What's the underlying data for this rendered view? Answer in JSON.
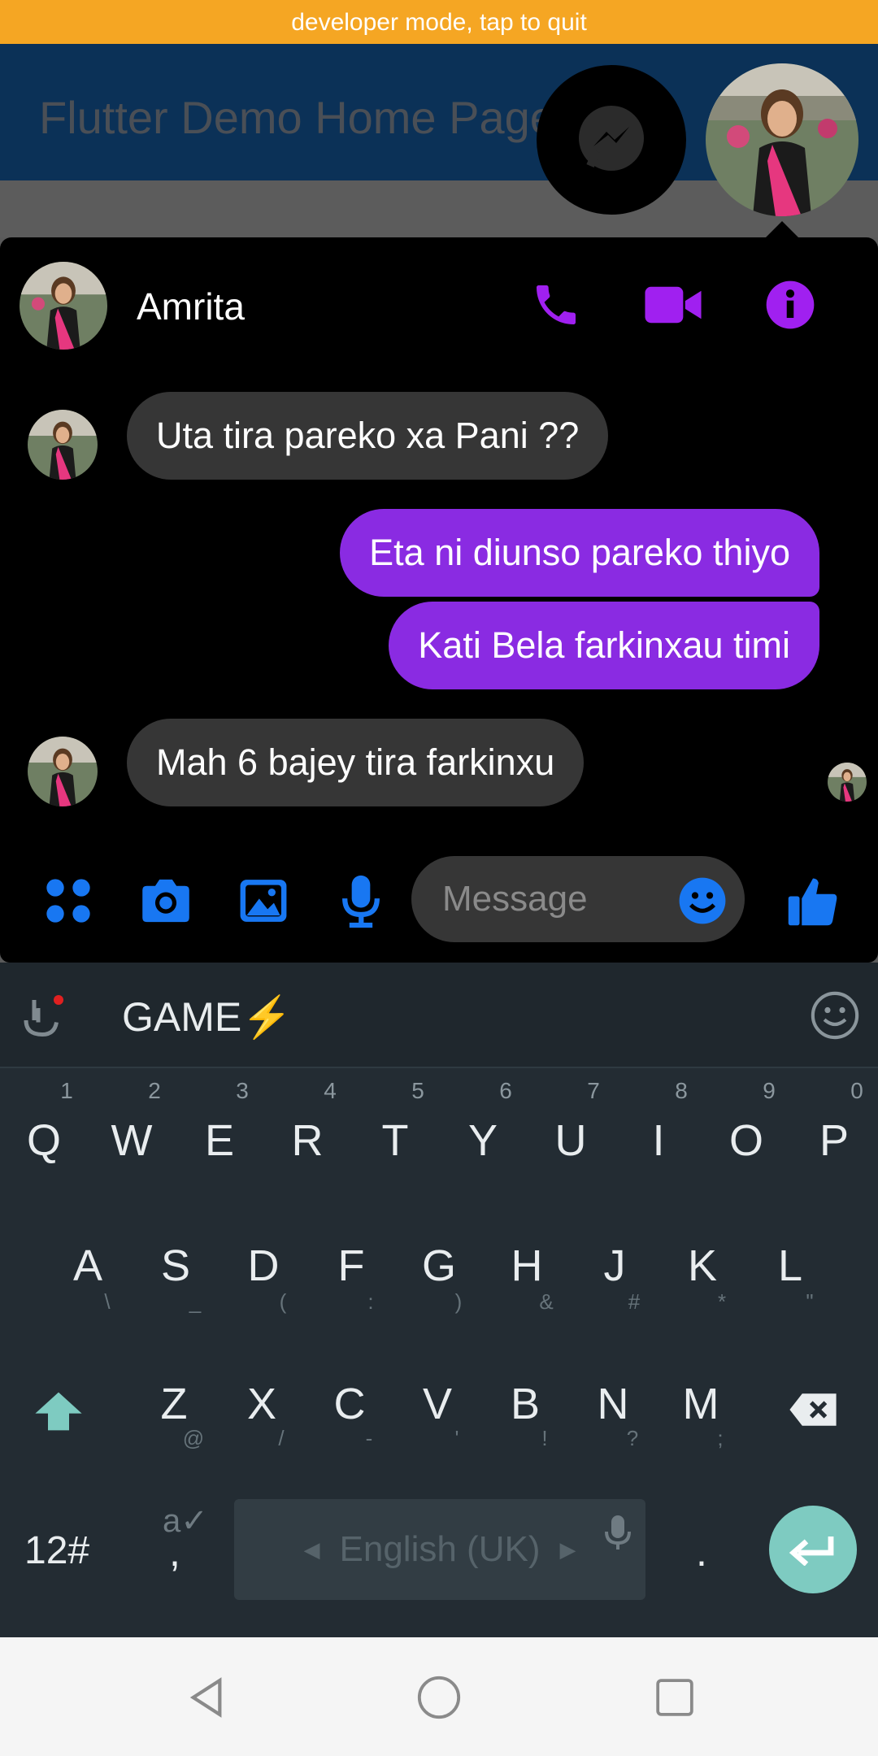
{
  "status": {
    "developer_mode": "developer mode, tap to quit"
  },
  "app": {
    "title": "Flutter Demo Home Page"
  },
  "chat": {
    "contact_name": "Amrita",
    "accent_color": "#8a2be2",
    "icon_color": "#a020f0",
    "messages": [
      {
        "direction": "incoming",
        "text": "Uta tira pareko xa Pani ??"
      },
      {
        "direction": "outgoing",
        "text": "Eta ni diunso pareko thiyo"
      },
      {
        "direction": "outgoing",
        "text": "Kati Bela farkinxau timi"
      },
      {
        "direction": "incoming",
        "text": "Mah 6 bajey tira farkinxu"
      }
    ],
    "composer": {
      "placeholder": "Message",
      "icon_color": "#1877f2"
    }
  },
  "keyboard": {
    "suggestion": "GAME⚡",
    "row1": [
      "Q",
      "W",
      "E",
      "R",
      "T",
      "Y",
      "U",
      "I",
      "O",
      "P"
    ],
    "row1_hints": [
      "1",
      "2",
      "3",
      "4",
      "5",
      "6",
      "7",
      "8",
      "9",
      "0"
    ],
    "row2": [
      "A",
      "S",
      "D",
      "F",
      "G",
      "H",
      "J",
      "K",
      "L"
    ],
    "row2_subs": [
      "\\",
      "_",
      "(",
      ":",
      ")",
      "&",
      "#",
      "*",
      "\""
    ],
    "row3": [
      "Z",
      "X",
      "C",
      "V",
      "B",
      "N",
      "M"
    ],
    "row3_subs": [
      "@",
      "/",
      "-",
      "'",
      "!",
      "?",
      ";"
    ],
    "symbols_key": "12#",
    "comma_key": ",",
    "period_key": ".",
    "language": "English (UK)"
  },
  "icons": {
    "messenger": "messenger-icon",
    "call": "phone-icon",
    "video": "video-icon",
    "info": "info-icon",
    "apps": "apps-icon",
    "camera": "camera-icon",
    "gallery": "image-icon",
    "mic": "mic-icon",
    "emoji": "emoji-icon",
    "like": "thumbs-up-icon"
  }
}
